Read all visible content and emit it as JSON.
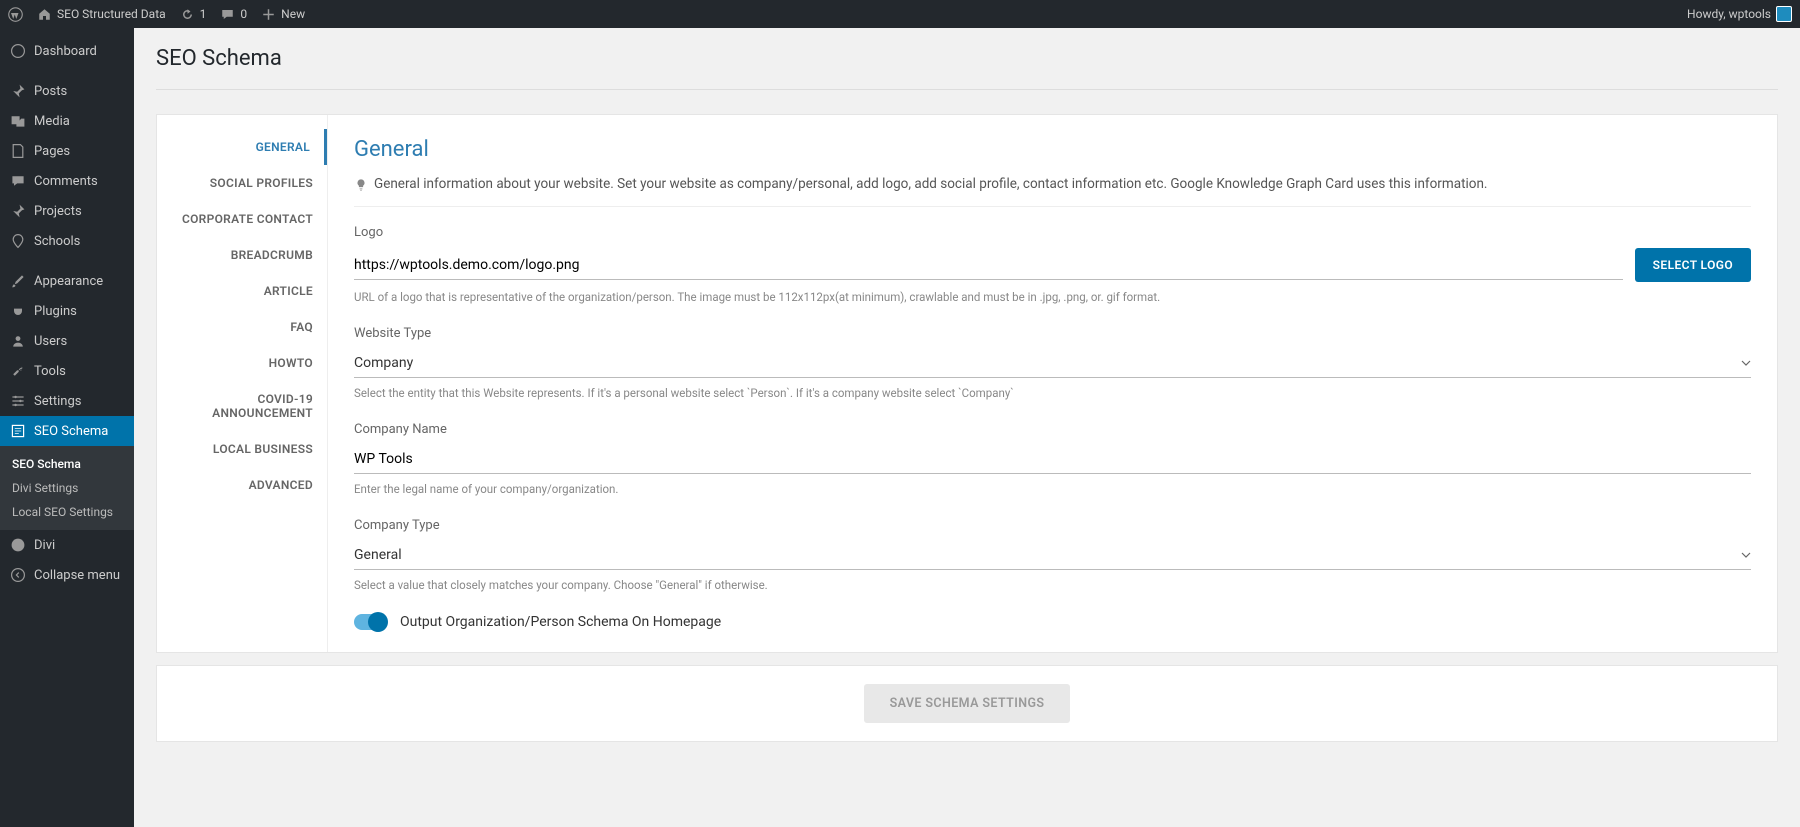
{
  "admin_bar": {
    "site_name": "SEO Structured Data",
    "refresh_count": "1",
    "comments_count": "0",
    "new_label": "New",
    "greeting": "Howdy, wptools"
  },
  "sidebar": {
    "items": [
      {
        "label": "Dashboard"
      },
      {
        "label": "Posts"
      },
      {
        "label": "Media"
      },
      {
        "label": "Pages"
      },
      {
        "label": "Comments"
      },
      {
        "label": "Projects"
      },
      {
        "label": "Schools"
      },
      {
        "label": "Appearance"
      },
      {
        "label": "Plugins"
      },
      {
        "label": "Users"
      },
      {
        "label": "Tools"
      },
      {
        "label": "Settings"
      },
      {
        "label": "SEO Schema"
      },
      {
        "label": "Divi"
      },
      {
        "label": "Collapse menu"
      }
    ],
    "submenu": [
      {
        "label": "SEO Schema"
      },
      {
        "label": "Divi Settings"
      },
      {
        "label": "Local SEO Settings"
      }
    ]
  },
  "page": {
    "title": "SEO Schema"
  },
  "tabs": [
    {
      "label": "GENERAL"
    },
    {
      "label": "SOCIAL PROFILES"
    },
    {
      "label": "CORPORATE CONTACT"
    },
    {
      "label": "BREADCRUMB"
    },
    {
      "label": "ARTICLE"
    },
    {
      "label": "FAQ"
    },
    {
      "label": "HOWTO"
    },
    {
      "label": "COVID-19 ANNOUNCEMENT"
    },
    {
      "label": "LOCAL BUSINESS"
    },
    {
      "label": "ADVANCED"
    }
  ],
  "form": {
    "section_title": "General",
    "section_desc": "General information about your website. Set your website as company/personal, add logo, add social profile, contact information etc. Google Knowledge Graph Card uses this information.",
    "logo": {
      "label": "Logo",
      "value": "https://wptools.demo.com/logo.png",
      "button": "SELECT LOGO",
      "help": "URL of a logo that is representative of the organization/person. The image must be 112x112px(at minimum), crawlable and must be in .jpg, .png, or. gif format."
    },
    "website_type": {
      "label": "Website Type",
      "value": "Company",
      "help": "Select the entity that this Website represents. If it's a personal website select `Person`. If it's a company website select `Company`"
    },
    "company_name": {
      "label": "Company Name",
      "value": "WP Tools",
      "help": "Enter the legal name of your company/organization."
    },
    "company_type": {
      "label": "Company Type",
      "value": "General",
      "help": "Select a value that closely matches your company. Choose \"General\" if otherwise."
    },
    "toggle_label": "Output Organization/Person Schema On Homepage",
    "save_button": "SAVE SCHEMA SETTINGS"
  }
}
